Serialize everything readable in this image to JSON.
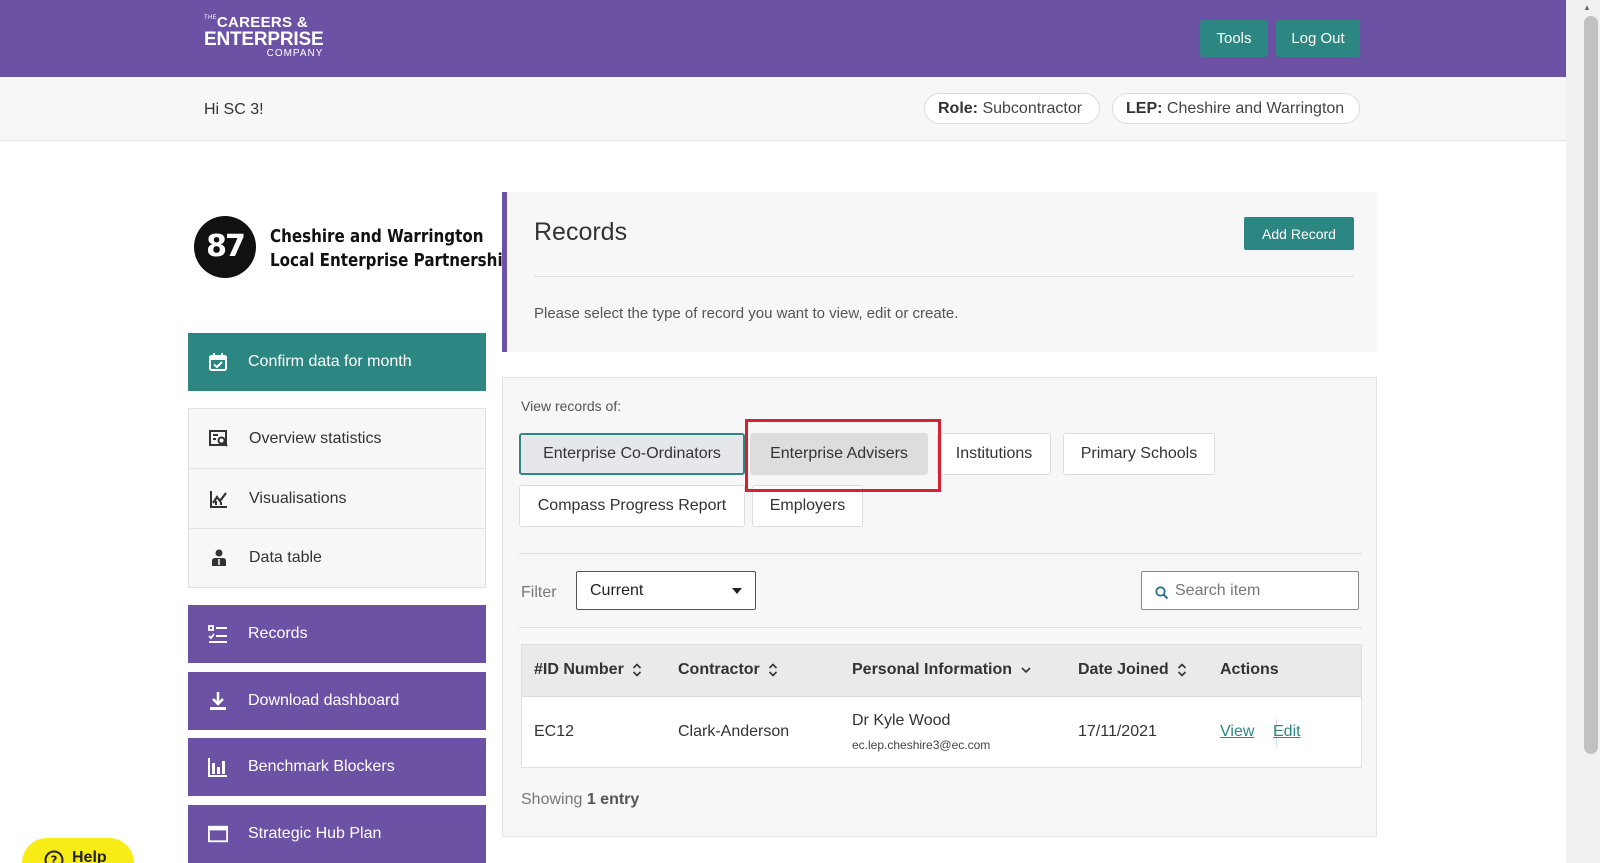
{
  "header": {
    "logo_line1_small": "THE",
    "logo_line1": "CAREERS",
    "logo_amp": "&",
    "logo_line2": "ENTERPRISE",
    "logo_line3": "COMPANY",
    "tools_label": "Tools",
    "logout_label": "Log Out"
  },
  "subbar": {
    "greeting": "Hi SC 3!",
    "role_label": "Role:",
    "role_value": "Subcontractor",
    "lep_label": "LEP:",
    "lep_value": "Cheshire and Warrington"
  },
  "lep_logo": {
    "mark": "87",
    "line1": "Cheshire and Warrington",
    "line2": "Local Enterprise Partnership"
  },
  "sidebar": {
    "items": [
      {
        "label": "Confirm data for month",
        "icon": "calendar-check-icon"
      },
      {
        "label": "Overview statistics",
        "icon": "search-document-icon"
      },
      {
        "label": "Visualisations",
        "icon": "chart-line-icon"
      },
      {
        "label": "Data table",
        "icon": "person-icon"
      },
      {
        "label": "Records",
        "icon": "list-check-icon"
      },
      {
        "label": "Download dashboard",
        "icon": "download-icon"
      },
      {
        "label": "Benchmark Blockers",
        "icon": "bar-chart-icon"
      },
      {
        "label": "Strategic Hub Plan",
        "icon": "window-icon"
      }
    ]
  },
  "records": {
    "title": "Records",
    "add_label": "Add Record",
    "description": "Please select the type of record you want to view, edit or create.",
    "view_label": "View records of:",
    "tabs": [
      {
        "label": "Enterprise Co-Ordinators",
        "state": "selected"
      },
      {
        "label": "Enterprise Advisers",
        "state": "hover"
      },
      {
        "label": "Institutions",
        "state": "default"
      },
      {
        "label": "Primary Schools",
        "state": "default"
      },
      {
        "label": "Compass Progress Report",
        "state": "default"
      },
      {
        "label": "Employers",
        "state": "default"
      }
    ],
    "filter_label": "Filter",
    "filter_value": "Current",
    "search_placeholder": "Search item",
    "columns": [
      "#ID Number",
      "Contractor",
      "Personal Information",
      "Date Joined",
      "Actions"
    ],
    "rows": [
      {
        "id": "EC12",
        "contractor": "Clark-Anderson",
        "name": "Dr Kyle Wood",
        "email": "ec.lep.cheshire3@ec.com",
        "date_joined": "17/11/2021",
        "view_label": "View",
        "edit_label": "Edit"
      }
    ],
    "showing_prefix": "Showing",
    "showing_count": "1 entry"
  },
  "help_label": "Help",
  "colors": {
    "brand_purple": "#6c52a5",
    "accent_teal": "#2c8782",
    "highlight_red": "#d62130",
    "help_yellow": "#f7ec15"
  }
}
